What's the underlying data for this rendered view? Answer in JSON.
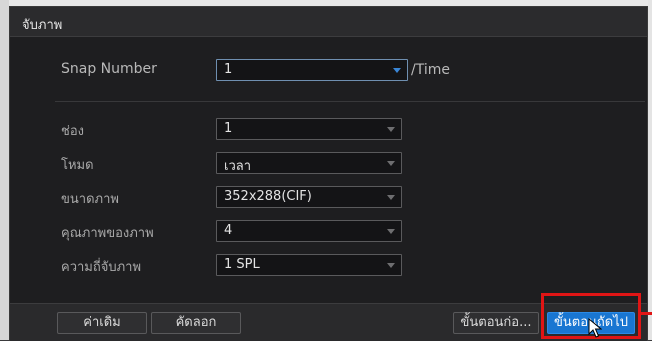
{
  "dialog": {
    "title": "จับภาพ"
  },
  "snap": {
    "label": "Snap Number",
    "value": "1",
    "suffix": "/Time"
  },
  "fields": [
    {
      "label": "ช่อง",
      "value": "1"
    },
    {
      "label": "โหมด",
      "value": "เวลา"
    },
    {
      "label": "ขนาดภาพ",
      "value": "352x288(CIF)"
    },
    {
      "label": "คุณภาพของภาพ",
      "value": "4"
    },
    {
      "label": "ความถี่จับภาพ",
      "value": "1 SPL"
    }
  ],
  "buttons": {
    "default": "ค่าเดิม",
    "copy": "คัดลอก",
    "back": "ขั้นตอนก่อ...",
    "next": "ขั้นตอนถัดไป"
  },
  "colors": {
    "accent": "#1976d2",
    "highlight": "#e01515",
    "background": "#1e1e20"
  },
  "icons": [
    "chevron-down-icon",
    "mouse-cursor-icon"
  ]
}
